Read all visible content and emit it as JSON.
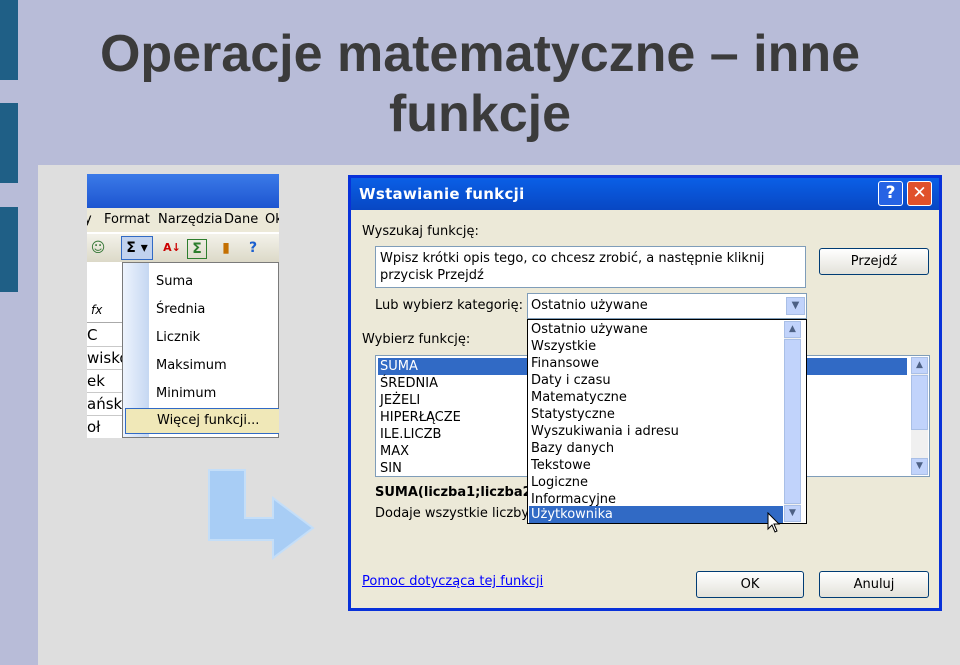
{
  "slide": {
    "title": "Operacje matematyczne – inne funkcje"
  },
  "excel": {
    "menu": [
      "y",
      "Format",
      "Narzędzia",
      "Dane",
      "Ok"
    ],
    "fx_label": "fx",
    "cells": [
      "C",
      "wisko",
      "ek",
      "ańska",
      "oł"
    ],
    "autosum_menu": [
      "Suma",
      "Średnia",
      "Licznik",
      "Maksimum",
      "Minimum"
    ],
    "more_functions": "Więcej funkcji..."
  },
  "dialog": {
    "title": "Wstawianie funkcji",
    "help_btn": "?",
    "close_btn": "✕",
    "search_label": "Wyszukaj funkcję:",
    "search_text": "Wpisz krótki opis tego, co chcesz zrobić, a następnie kliknij przycisk Przejdź",
    "go_button": "Przejdź",
    "category_label": "Lub wybierz kategorię:",
    "category_value": "Ostatnio używane",
    "select_label": "Wybierz funkcję:",
    "functions": [
      "SUMA",
      "ŚREDNIA",
      "JEŻELI",
      "HIPERŁĄCZE",
      "ILE.LICZB",
      "MAX",
      "SIN"
    ],
    "selected_function": "SUMA",
    "signature": "SUMA(liczba1;liczba2",
    "description": "Dodaje wszystkie liczby",
    "categories": [
      "Ostatnio używane",
      "Wszystkie",
      "Finansowe",
      "Daty i czasu",
      "Matematyczne",
      "Statystyczne",
      "Wyszukiwania i adresu",
      "Bazy danych",
      "Tekstowe",
      "Logiczne",
      "Informacyjne",
      "Użytkownika"
    ],
    "highlighted_category": "Użytkownika",
    "help_link": "Pomoc dotycząca tej funkcji",
    "ok_button": "OK",
    "cancel_button": "Anuluj"
  },
  "colors": {
    "titlebar": "#0a5fe6",
    "selection": "#316ac5",
    "slide_bg": "#b8bcd8",
    "arrow": "#a8cdf5"
  }
}
